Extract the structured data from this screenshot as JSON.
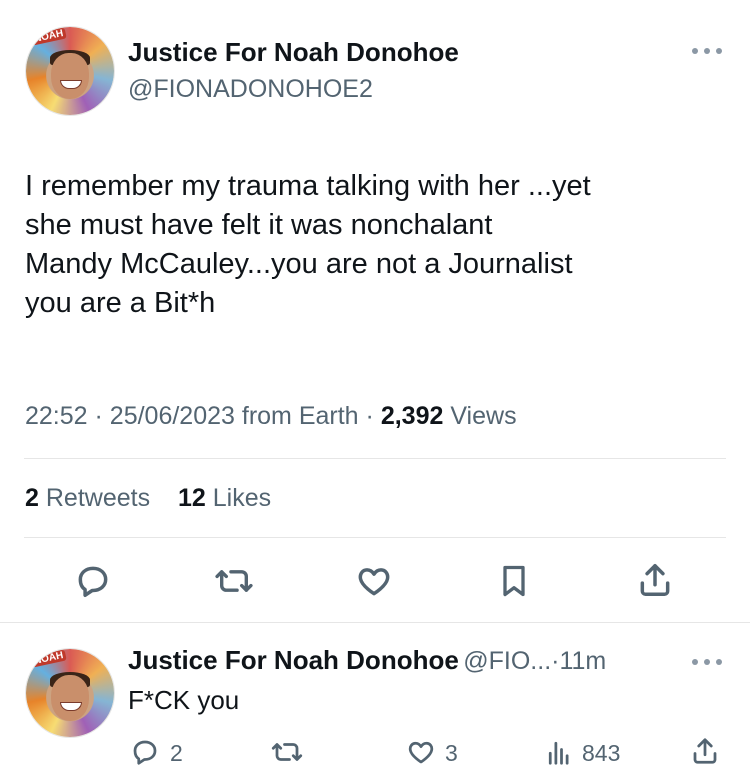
{
  "main_tweet": {
    "author_name": "Justice For Noah Donohoe",
    "handle": "@FIONADONOHOE2",
    "text_lines": [
      "I remember my trauma talking with her ...yet",
      "she must have felt it was nonchalant",
      "Mandy McCauley...you are not a Journalist",
      "you are a Bit*h"
    ],
    "time": "22:52",
    "date": "25/06/2023",
    "source": "from Earth",
    "views_count": "2,392",
    "views_label": "Views",
    "retweets_count": "2",
    "retweets_label": "Retweets",
    "likes_count": "12",
    "likes_label": "Likes",
    "avatar_text": "NOAH"
  },
  "reply": {
    "author_name": "Justice For Noah Donohoe",
    "handle": "@FIO...",
    "separator": "·",
    "time": "11m",
    "text": "F*CK you",
    "reply_count": "2",
    "like_count": "3",
    "views_count": "843",
    "avatar_text": "NOAH"
  },
  "icons": {
    "more": "more-icon",
    "reply": "reply-icon",
    "retweet": "retweet-icon",
    "like": "like-icon",
    "bookmark": "bookmark-icon",
    "share": "share-icon",
    "views": "views-icon"
  },
  "colors": {
    "text": "#0f1419",
    "secondary": "#536471",
    "divider": "#e6e6e6"
  }
}
